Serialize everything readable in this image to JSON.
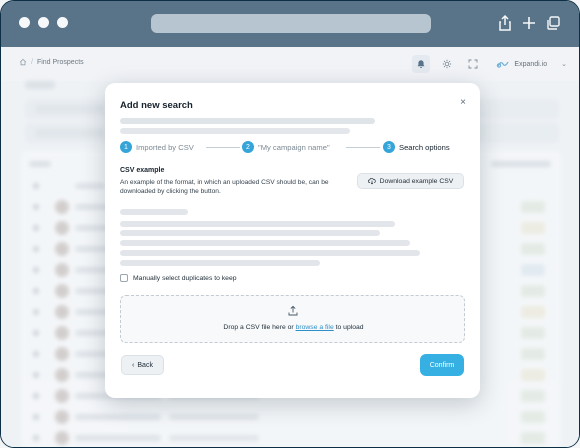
{
  "breadcrumb": {
    "label": "Find Prospects"
  },
  "nav": {
    "brand": "Expandi.io"
  },
  "modal": {
    "title": "Add new search",
    "close": "×",
    "steps": [
      {
        "num": "1",
        "label": "Imported by CSV"
      },
      {
        "num": "2",
        "label": "\"My campaign name\""
      },
      {
        "num": "3",
        "label": "Search options"
      }
    ],
    "csv_heading": "CSV example",
    "csv_desc": "An example of the format, in which an uploaded CSV should be, can be downloaded by clicking the button.",
    "download_label": "Download example CSV",
    "checkbox_label": "Manually select duplicates to keep",
    "drop_before": "Drop a CSV file here or ",
    "drop_link": "browse a file",
    "drop_after": " to upload",
    "back_label": "Back",
    "back_arrow": "‹",
    "confirm_label": "Confirm"
  }
}
